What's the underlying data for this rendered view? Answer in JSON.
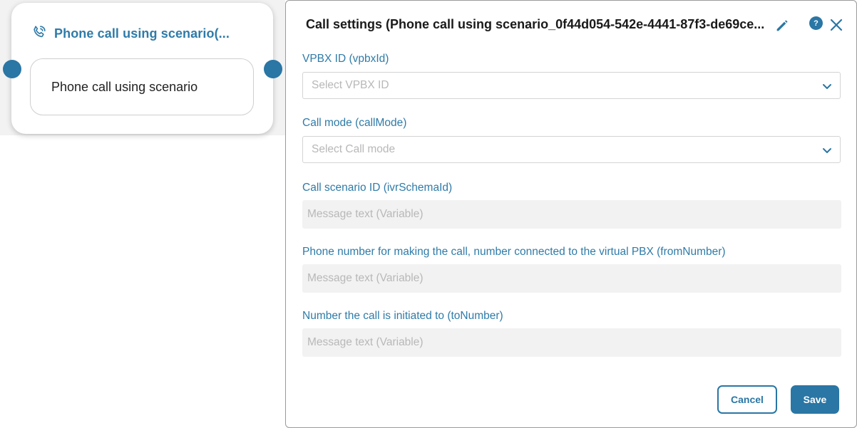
{
  "canvas": {
    "node": {
      "title": "Phone call using scenario(...",
      "body_text": "Phone call using scenario",
      "icon": "phone-icon"
    }
  },
  "panel": {
    "title": "Call settings (Phone call using scenario_0f44d054-542e-4441-87f3-de69ce...",
    "icons": [
      "pencil-icon",
      "help-icon",
      "close-icon"
    ],
    "help_label": "?",
    "fields": [
      {
        "label": "VPBX ID (vpbxId)",
        "type": "select",
        "placeholder": "Select VPBX ID"
      },
      {
        "label": "Call mode (callMode)",
        "type": "select",
        "placeholder": "Select Call mode"
      },
      {
        "label": "Call scenario ID (ivrSchemaId)",
        "type": "text",
        "placeholder": "Message text (Variable)"
      },
      {
        "label": "Phone number for making the call, number connected to the virtual PBX (fromNumber)",
        "type": "text",
        "placeholder": "Message text (Variable)"
      },
      {
        "label": "Number the call is initiated to (toNumber)",
        "type": "text",
        "placeholder": "Message text (Variable)"
      }
    ],
    "buttons": {
      "cancel": "Cancel",
      "save": "Save"
    }
  },
  "colors": {
    "accent": "#2a76a5",
    "label": "#2f7ba8",
    "placeholder": "#b8b8b8",
    "input_bg": "#f2f2f2"
  }
}
